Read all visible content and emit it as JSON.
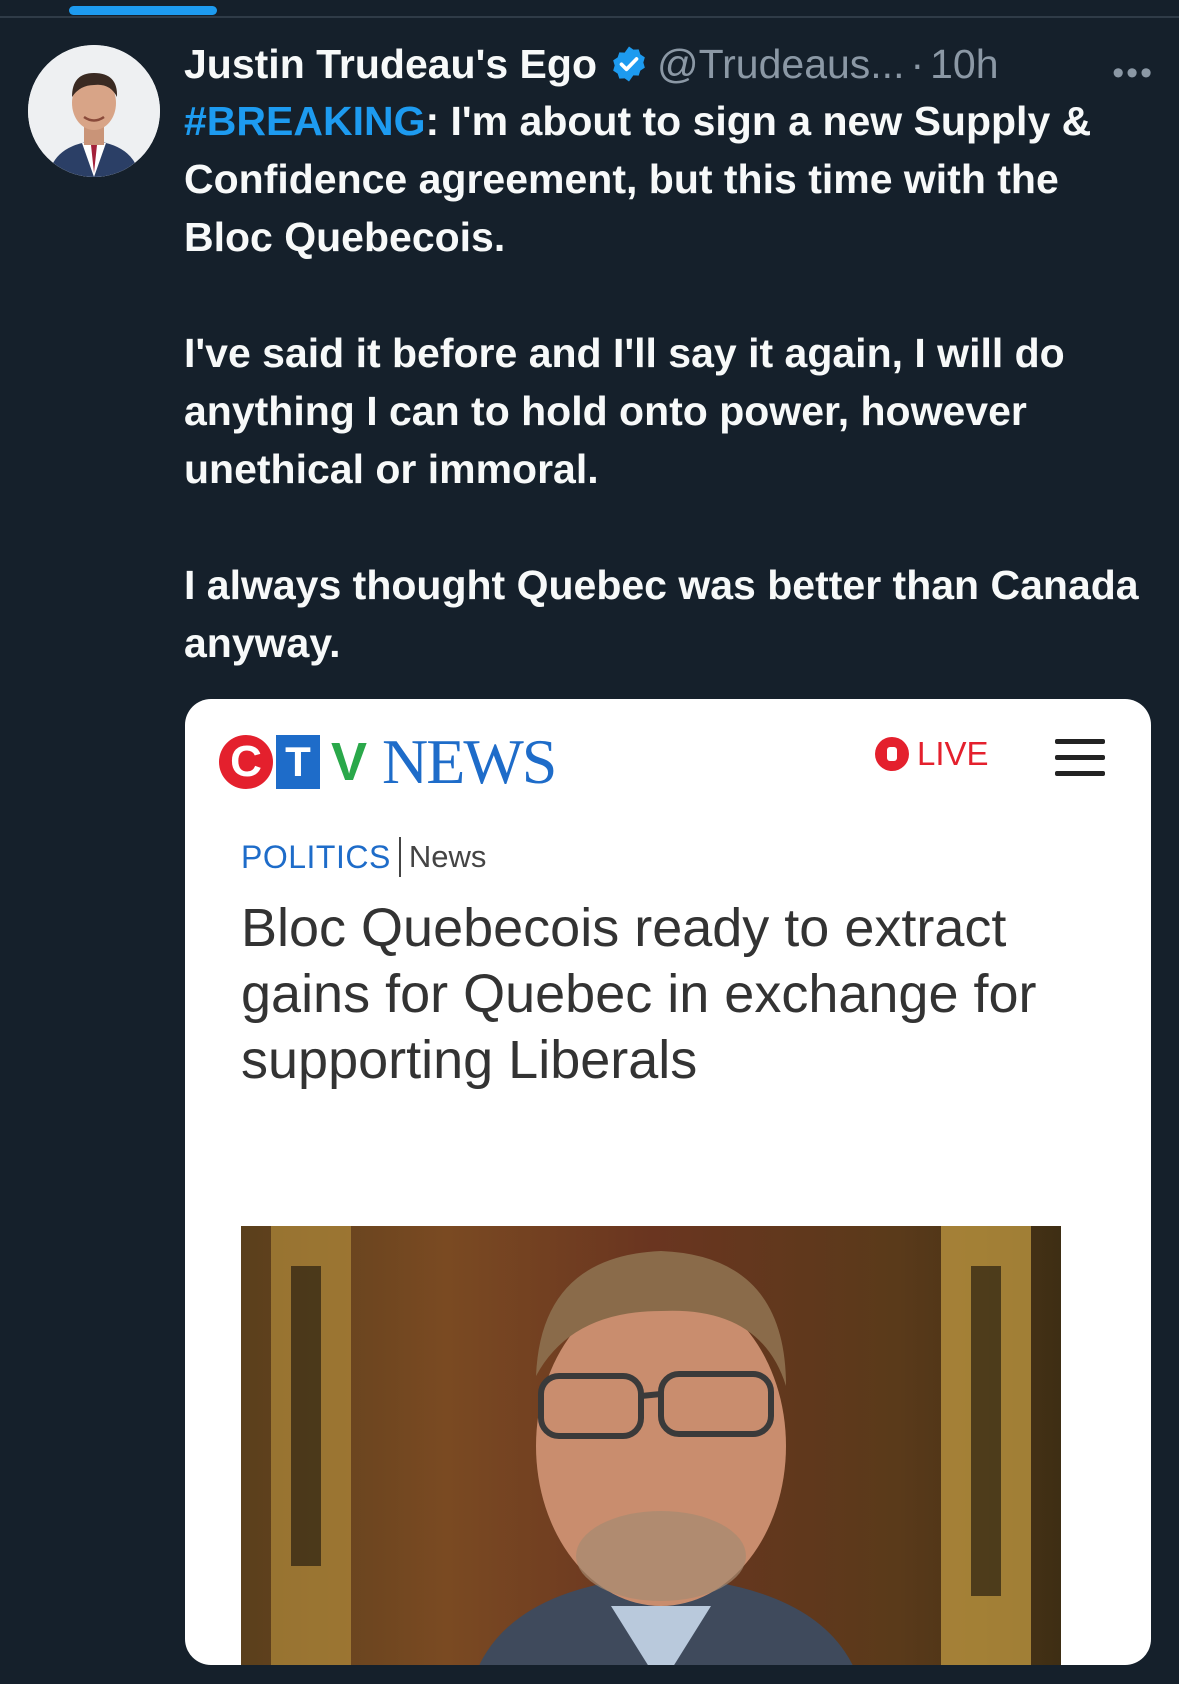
{
  "tweet": {
    "author_name": "Justin Trudeau's Ego",
    "handle": "@Trudeaus...",
    "separator": "·",
    "time": "10h",
    "more": "•••",
    "hashtag": "#BREAKING",
    "paragraph1_rest": ": I'm about to sign a new Supply & Confidence agreement, but this time with the Bloc Quebecois.",
    "paragraph2": "I've said it before and I'll say it again, I will do anything I can to hold onto power, however unethical or immoral.",
    "paragraph3": "I always thought Quebec was better than Canada anyway."
  },
  "card": {
    "logo_c": "C",
    "logo_t": "T",
    "logo_v": "V",
    "logo_news": "NEWS",
    "live_label": "LIVE",
    "section": "POLITICS",
    "subsection": "News",
    "headline": "Bloc Quebecois ready to extract gains for Quebec in exchange for supporting Liberals"
  },
  "colors": {
    "background": "#15202b",
    "accent": "#1d9bf0",
    "ctv_red": "#e4202d",
    "ctv_blue": "#1e6cc9",
    "ctv_green": "#2aa84a"
  }
}
